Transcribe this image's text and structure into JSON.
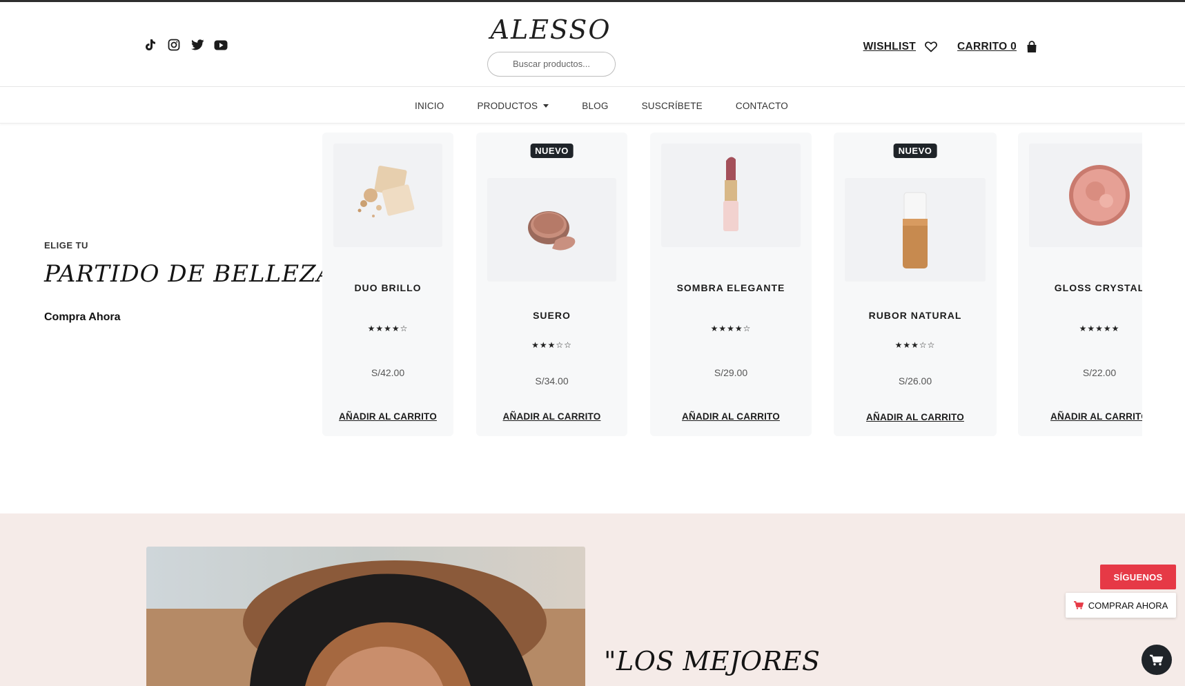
{
  "brand": {
    "logo": "ALESSO"
  },
  "socials": [
    {
      "icon": "tiktok-icon"
    },
    {
      "icon": "instagram-icon"
    },
    {
      "icon": "twitter-icon"
    },
    {
      "icon": "youtube-icon"
    }
  ],
  "search": {
    "placeholder": "Buscar productos..."
  },
  "account": {
    "wishlist": "WISHLIST",
    "cart": "CARRITO 0"
  },
  "nav": {
    "items": [
      "INICIO",
      "PRODUCTOS",
      "BLOG",
      "SUSCRÍBETE",
      "CONTACTO"
    ]
  },
  "hero": {
    "eyebrow": "ELIGE TU",
    "title": "PARTIDO DE BELLEZA",
    "cta": "Compra Ahora"
  },
  "products": [
    {
      "name": "DUO BRILLO",
      "stars": "★★★★☆",
      "rating": 4,
      "price": "S/42.00",
      "add": "AÑADIR AL CARRITO",
      "badge": ""
    },
    {
      "name": "SUERO",
      "stars": "★★★☆☆",
      "rating": 3,
      "price": "S/34.00",
      "add": "AÑADIR AL CARRITO",
      "badge": "NUEVO"
    },
    {
      "name": "SOMBRA ELEGANTE",
      "stars": "★★★★☆",
      "rating": 4,
      "price": "S/29.00",
      "add": "AÑADIR AL CARRITO",
      "badge": ""
    },
    {
      "name": "RUBOR NATURAL",
      "stars": "★★★☆☆",
      "rating": 3,
      "price": "S/26.00",
      "add": "AÑADIR AL CARRITO",
      "badge": "NUEVO"
    },
    {
      "name": "GLOSS CRYSTAL",
      "stars": "★★★★★",
      "rating": 5,
      "price": "S/22.00",
      "add": "AÑADIR AL CARRITO",
      "badge": ""
    }
  ],
  "section2": {
    "quote": "\"LOS MEJORES"
  },
  "floating": {
    "follow": "SÍGUENOS",
    "buy": "COMPRAR AHORA"
  },
  "colors": {
    "accent_red": "#e63946",
    "dark": "#1f2429",
    "section_bg": "#f5ebe8",
    "card_bg": "#f7f8f9"
  }
}
